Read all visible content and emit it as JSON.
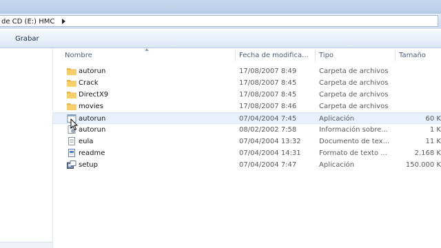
{
  "address": {
    "path": "de CD (E:) HMC"
  },
  "toolbar": {
    "burn_label": "Grabar"
  },
  "columns": {
    "name": "Nombre",
    "date": "Fecha de modifica...",
    "type": "Tipo",
    "size": "Tamaño"
  },
  "files": [
    {
      "name": "autorun",
      "date": "17/08/2007 8:49",
      "type": "Carpeta de archivos",
      "size": "",
      "icon": "folder-icon"
    },
    {
      "name": "Crack",
      "date": "17/08/2007 8:45",
      "type": "Carpeta de archivos",
      "size": "",
      "icon": "folder-icon"
    },
    {
      "name": "DirectX9",
      "date": "17/08/2007 8:45",
      "type": "Carpeta de archivos",
      "size": "",
      "icon": "folder-icon"
    },
    {
      "name": "movies",
      "date": "17/08/2007 8:46",
      "type": "Carpeta de archivos",
      "size": "",
      "icon": "folder-icon"
    },
    {
      "name": "autorun",
      "date": "07/04/2004 7:45",
      "type": "Aplicación",
      "size": "60 K",
      "icon": "application-icon"
    },
    {
      "name": "autorun",
      "date": "08/02/2002 7:58",
      "type": "Información sobre...",
      "size": "1 K",
      "icon": "setup-info-icon"
    },
    {
      "name": "eula",
      "date": "07/04/2004 13:32",
      "type": "Documento de tex...",
      "size": "11 K",
      "icon": "text-document-icon"
    },
    {
      "name": "readme",
      "date": "07/04/2004 14:31",
      "type": "Formato de texto ...",
      "size": "2.168 K",
      "icon": "rich-text-icon"
    },
    {
      "name": "setup",
      "date": "07/04/2004 7:47",
      "type": "Aplicación",
      "size": "150.000 K",
      "icon": "setup-application-icon"
    }
  ],
  "colors": {
    "folder": "#e8b54a",
    "selection": "#e8f1fb",
    "header_text": "#4c607a"
  }
}
